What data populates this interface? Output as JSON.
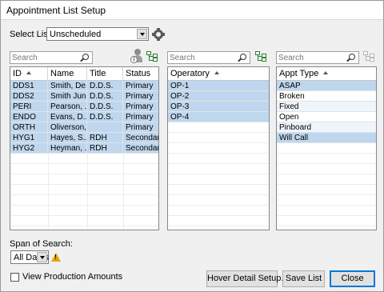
{
  "window": {
    "title": "Appointment List Setup"
  },
  "select_list": {
    "label": "Select List:",
    "value": "Unscheduled"
  },
  "providers": {
    "search_placeholder": "Search",
    "columns": [
      "ID",
      "Name",
      "Title",
      "Status"
    ],
    "rows": [
      {
        "id": "DDS1",
        "name": "Smith, De...",
        "title": "D.D.S.",
        "status": "Primary",
        "selected": true
      },
      {
        "id": "DDS2",
        "name": "Smith Juni...",
        "title": "D.D.S.",
        "status": "Primary",
        "selected": true
      },
      {
        "id": "PERI",
        "name": "Pearson, ...",
        "title": "D.D.S.",
        "status": "Primary",
        "selected": true
      },
      {
        "id": "ENDO",
        "name": "Evans, D...",
        "title": "D.D.S.",
        "status": "Primary",
        "selected": true
      },
      {
        "id": "ORTH",
        "name": "Oliverson,...",
        "title": "",
        "status": "Primary",
        "selected": true
      },
      {
        "id": "HYG1",
        "name": "Hayes, S...",
        "title": "RDH",
        "status": "Secondary",
        "selected": true
      },
      {
        "id": "HYG2",
        "name": "Heyman, ...",
        "title": "RDH",
        "status": "Secondary",
        "selected": true
      }
    ]
  },
  "operatories": {
    "search_placeholder": "Search",
    "column": "Operatory",
    "rows": [
      {
        "label": "OP-1",
        "selected": true
      },
      {
        "label": "OP-2",
        "selected": true
      },
      {
        "label": "OP-3",
        "selected": true
      },
      {
        "label": "OP-4",
        "selected": true
      }
    ]
  },
  "appt_types": {
    "search_placeholder": "Search",
    "column": "Appt Type",
    "rows": [
      {
        "label": "ASAP",
        "selected": true
      },
      {
        "label": "Broken",
        "selected": false
      },
      {
        "label": "Fixed",
        "selected": false
      },
      {
        "label": "Open",
        "selected": false
      },
      {
        "label": "Pinboard",
        "selected": false
      },
      {
        "label": "Will Call",
        "selected": true
      }
    ]
  },
  "span": {
    "label": "Span of Search:",
    "value": "All Dates"
  },
  "view_production": {
    "label": "View Production Amounts",
    "checked": false
  },
  "buttons": {
    "hover_detail": "Hover Detail Setup...",
    "save_list": "Save List",
    "close": "Close"
  },
  "colors": {
    "selected_row": "#bfd7ee",
    "default_button_border": "#0078d7",
    "warning": "#e1a800"
  }
}
